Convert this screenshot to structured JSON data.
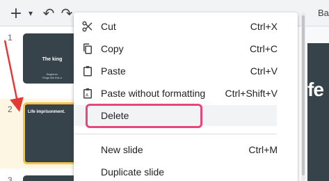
{
  "toolbar": {
    "items": [
      {
        "name": "new-slide-plus-icon",
        "glyph": "+"
      },
      {
        "name": "dropdown-caret-icon",
        "glyph": "▾"
      },
      {
        "name": "undo-icon",
        "glyph": "↶"
      },
      {
        "name": "redo-icon",
        "glyph": "↷"
      }
    ],
    "background_label": "Bac"
  },
  "filmstrip": {
    "slides": [
      {
        "number": "1",
        "title": "The king",
        "subtitle_line1": "Beginner",
        "subtitle_line2": "Kings like this a"
      },
      {
        "number": "2",
        "title": "Life imprisonment.",
        "selected": true
      },
      {
        "number": "3"
      }
    ]
  },
  "canvas": {
    "visible_text": "fe"
  },
  "context_menu": {
    "items": [
      {
        "icon": "scissors-icon",
        "label": "Cut",
        "shortcut": "Ctrl+X"
      },
      {
        "icon": "copy-icon",
        "label": "Copy",
        "shortcut": "Ctrl+C"
      },
      {
        "icon": "clipboard-icon",
        "label": "Paste",
        "shortcut": "Ctrl+V"
      },
      {
        "icon": "clipboard-text-icon",
        "label": "Paste without formatting",
        "shortcut": "Ctrl+Shift+V"
      },
      {
        "icon": "",
        "label": "Delete",
        "shortcut": "",
        "hovered": true
      },
      {
        "icon": "",
        "label": "New slide",
        "shortcut": "Ctrl+M"
      },
      {
        "icon": "",
        "label": "Duplicate slide",
        "shortcut": ""
      }
    ]
  },
  "colors": {
    "slide_dark": "#37434b",
    "selected_slide_border": "#f6c444",
    "annotation_pink": "#e8467a",
    "annotation_red": "#e53935",
    "menu_hover": "#f1f3f4"
  }
}
